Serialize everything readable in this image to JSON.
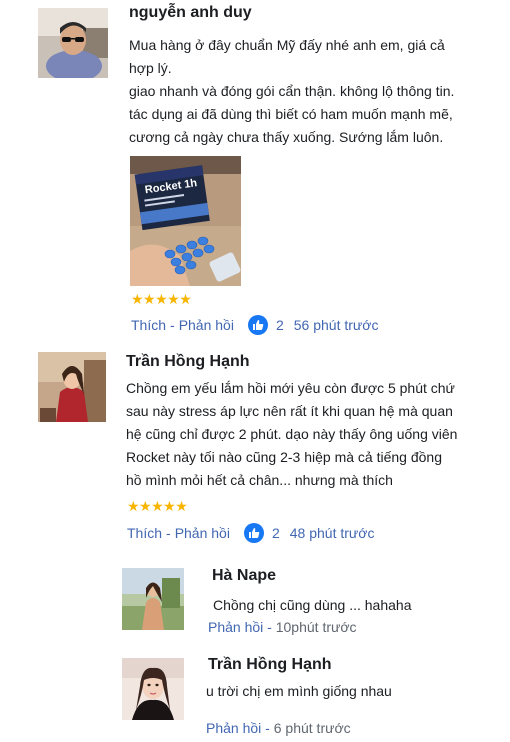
{
  "comments": [
    {
      "author": "nguyễn anh duy",
      "lines": [
        "Mua hàng ở đây chuẩn Mỹ đấy nhé anh em, giá cả",
        "hợp lý.",
        "giao nhanh và đóng gói cẩn thận. không lộ thông tin.",
        "tác dụng ai đã dùng thì biết có ham muốn mạnh mẽ,",
        "cương cả ngày chưa thấy xuống. Sướng lắm luôn."
      ],
      "photo_box_label": "Rocket 1h",
      "rating_stars": "★★★★★",
      "like_label": "Thích",
      "reply_label": "Phản hồi",
      "likes": "2",
      "time": "56 phút trước"
    },
    {
      "author": "Trần Hồng Hạnh",
      "lines": [
        "Chồng em yếu lắm hồi mới yêu còn được 5 phút chứ",
        "sau này stress áp lực nên rất ít khi quan hệ mà quan",
        "hệ cũng chỉ được 2 phút. dạo này thấy ông uống viên",
        "Rocket này tối nào cũng 2-3 hiệp mà cả tiếng đồng",
        "hồ mình mỏi hết cả chân... nhưng mà thích"
      ],
      "rating_stars": "★★★★★",
      "like_label": "Thích",
      "reply_label": "Phản hồi",
      "likes": "2",
      "time": "48 phút trước"
    }
  ],
  "replies": [
    {
      "author": "Hà Nape",
      "text": "Chồng chị cũng dùng ... hahaha",
      "reply_label": "Phản hồi",
      "time": "10phút trước"
    },
    {
      "author": "Trần Hồng Hạnh",
      "text": "u trời chị em mình giống nhau",
      "reply_label": "Phản hồi",
      "time": "6 phút trước"
    }
  ],
  "colors": {
    "link": "#4267b2",
    "star": "#f7b500",
    "like_bubble": "#1877f2"
  }
}
